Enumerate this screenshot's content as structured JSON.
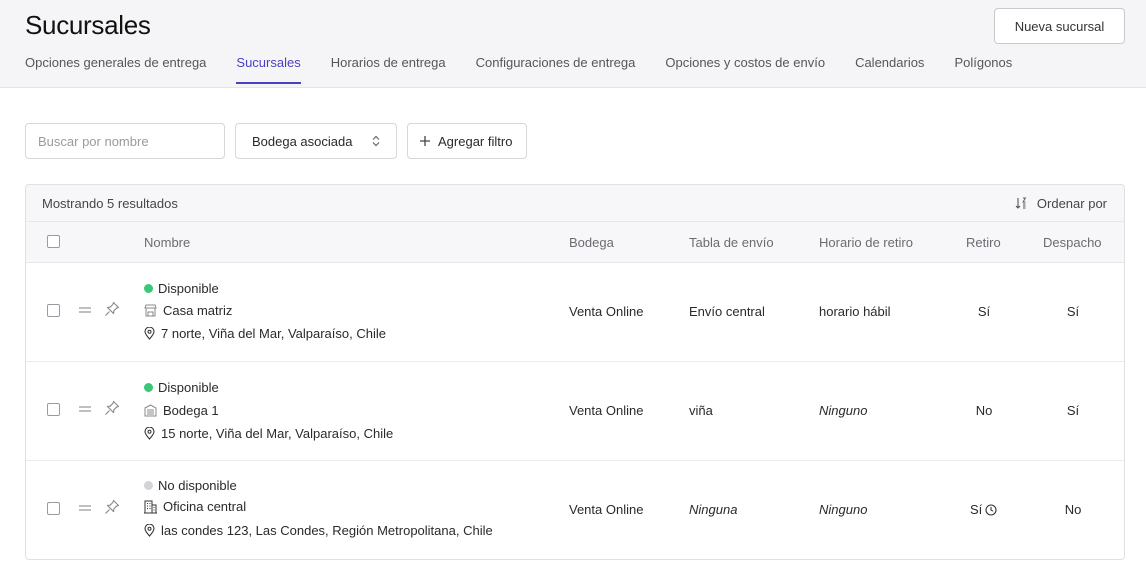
{
  "header": {
    "title": "Sucursales",
    "new_button": "Nueva sucursal",
    "tabs": [
      {
        "label": "Opciones generales de entrega"
      },
      {
        "label": "Sucursales"
      },
      {
        "label": "Horarios de entrega"
      },
      {
        "label": "Configuraciones de entrega"
      },
      {
        "label": "Opciones y costos de envío"
      },
      {
        "label": "Calendarios"
      },
      {
        "label": "Polígonos"
      }
    ]
  },
  "filters": {
    "search_placeholder": "Buscar por nombre",
    "warehouse_select": "Bodega asociada",
    "add_filter": "Agregar filtro"
  },
  "table": {
    "results_text": "Mostrando 5 resultados",
    "sort_label": "Ordenar por",
    "columns": {
      "name": "Nombre",
      "warehouse": "Bodega",
      "shipping_table": "Tabla de envío",
      "pickup_schedule": "Horario de retiro",
      "pickup": "Retiro",
      "dispatch": "Despacho"
    },
    "rows": [
      {
        "status": "Disponible",
        "status_color": "#3ac77a",
        "name": "Casa matriz",
        "name_icon": "store-icon",
        "address": "7 norte, Viña del Mar, Valparaíso, Chile",
        "warehouse": "Venta Online",
        "shipping_table": "Envío central",
        "pickup_schedule": "horario hábil",
        "pickup": "Sí",
        "dispatch": "Sí"
      },
      {
        "status": "Disponible",
        "status_color": "#3ac77a",
        "name": "Bodega 1",
        "name_icon": "warehouse-icon",
        "address": "15 norte, Viña del Mar, Valparaíso, Chile",
        "warehouse": "Venta Online",
        "shipping_table": "viña",
        "pickup_schedule": "Ninguno",
        "pickup": "No",
        "dispatch": "Sí"
      },
      {
        "status": "No disponible",
        "status_color": "#d3d3d8",
        "name": "Oficina central",
        "name_icon": "office-building-icon",
        "address": "las condes 123, Las Condes, Región Metropolitana, Chile",
        "warehouse": "Venta Online",
        "shipping_table": "Ninguna",
        "pickup_schedule": "Ninguno",
        "pickup": "Sí",
        "dispatch": "No"
      }
    ]
  },
  "colors": {
    "accent": "#4b3fc2",
    "available": "#3ac77a",
    "unavailable": "#d3d3d8"
  }
}
